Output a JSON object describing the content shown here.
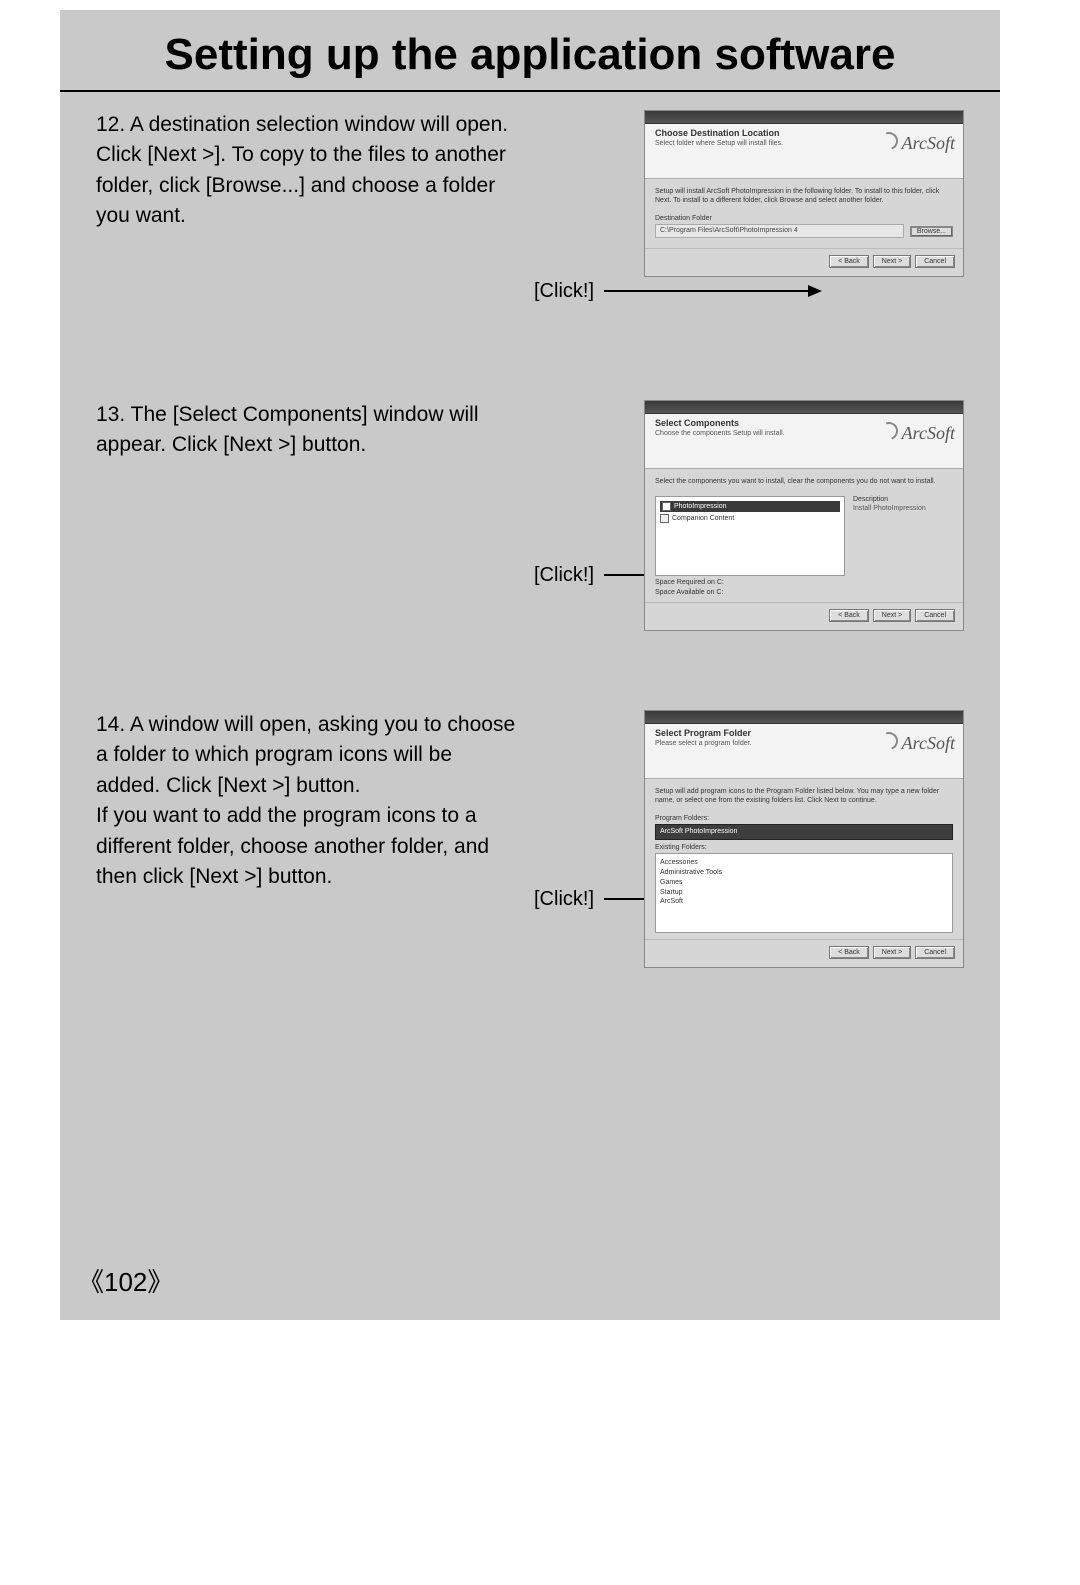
{
  "title": "Setting up the application software",
  "page_number": "102",
  "steps": [
    {
      "number": "12.",
      "text": "A destination selection window will open. Click [Next >]. To copy to the files to another folder, click [Browse...] and choose a folder you want.",
      "click_label": "[Click!]",
      "screenshot": {
        "logo": "ArcSoft",
        "header_line1": "Choose Destination Location",
        "header_line2": "Select folder where Setup will install files.",
        "body_text": "Setup will install ArcSoft PhotoImpression in the following folder.\nTo install to this folder, click Next. To install to a different folder, click Browse and select another folder.",
        "field_label": "Destination Folder",
        "path_value": "C:\\Program Files\\ArcSoft\\PhotoImpression 4",
        "browse_label": "Browse...",
        "buttons": {
          "back": "< Back",
          "next": "Next >",
          "cancel": "Cancel"
        }
      }
    },
    {
      "number": "13.",
      "text": "The [Select Components] window will appear. Click [Next >] button.",
      "click_label": "[Click!]",
      "screenshot": {
        "logo": "ArcSoft",
        "header_line1": "Select Components",
        "header_line2": "Choose the components Setup will install.",
        "body_text": "Select the components you want to install, clear the components you do not want to install.",
        "component_checked": "PhotoImpression",
        "component_other": "Companion Content",
        "right_label": "Description",
        "right_desc": "Install PhotoImpression",
        "space_req": "Space Required on C:",
        "space_avail": "Space Available on C:",
        "buttons": {
          "back": "< Back",
          "next": "Next >",
          "cancel": "Cancel"
        }
      }
    },
    {
      "number": "14.",
      "text": "A window will open, asking you to choose a folder to which program icons will be added. Click [Next >] button.\nIf you want to add the program icons to a different folder, choose another folder, and then click [Next >] button.",
      "click_label": "[Click!]",
      "screenshot": {
        "logo": "ArcSoft",
        "header_line1": "Select Program Folder",
        "header_line2": "Please select a program folder.",
        "body_text": "Setup will add program icons to the Program Folder listed below. You may type a new folder name, or select one from the existing folders list. Click Next to continue.",
        "field_label": "Program Folders:",
        "field_value": "ArcSoft PhotoImpression",
        "existing_label": "Existing Folders:",
        "folders": [
          "Accessories",
          "Administrative Tools",
          "Games",
          "Startup",
          "ArcSoft"
        ],
        "buttons": {
          "back": "< Back",
          "next": "Next >",
          "cancel": "Cancel"
        }
      }
    }
  ]
}
